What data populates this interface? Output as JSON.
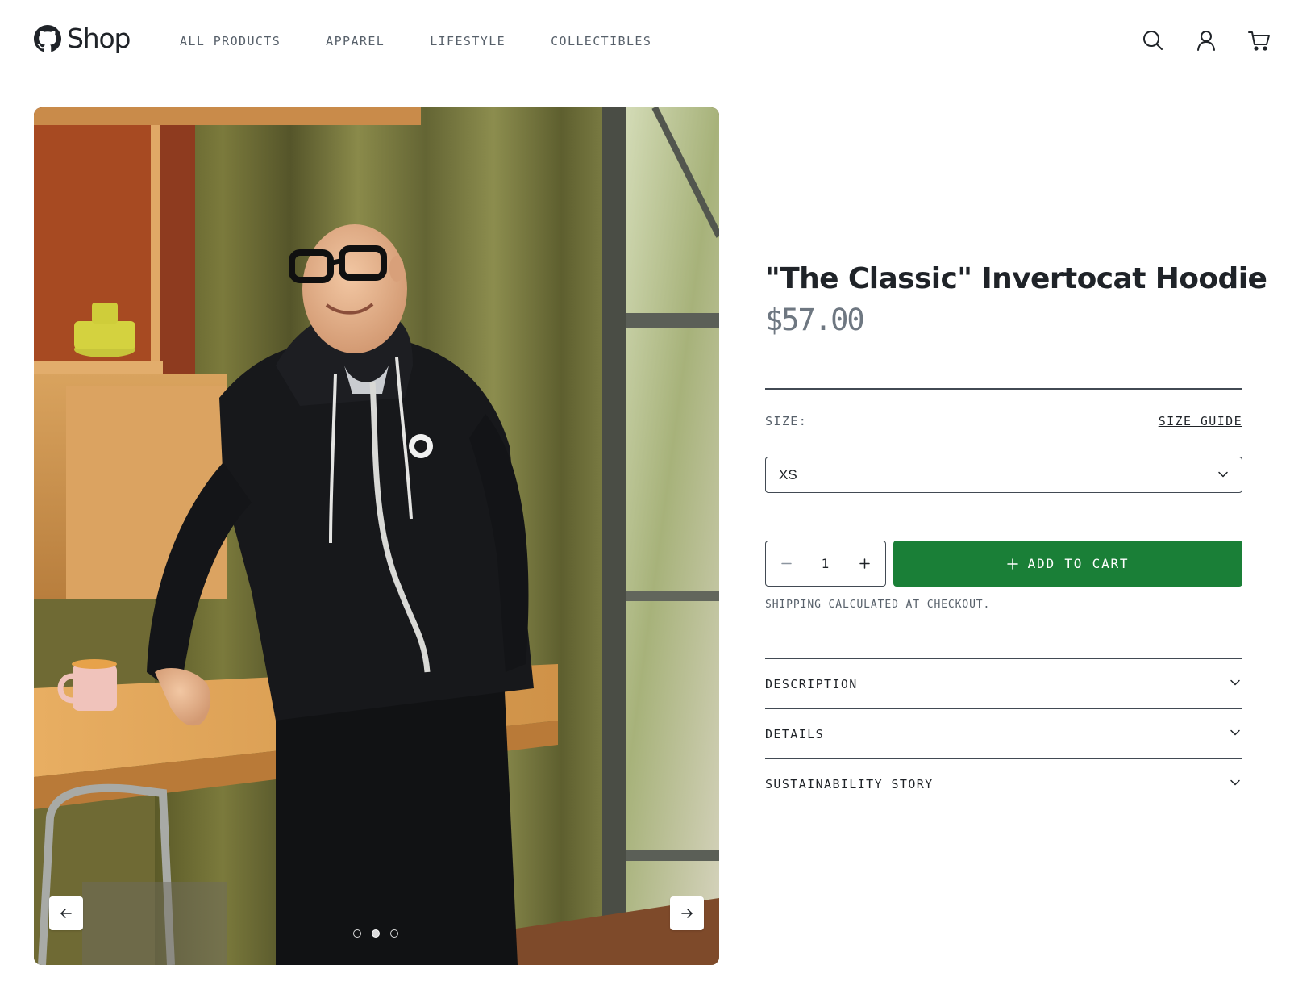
{
  "header": {
    "logo_text": "Shop",
    "nav": [
      {
        "label": "ALL PRODUCTS"
      },
      {
        "label": "APPAREL"
      },
      {
        "label": "LIFESTYLE"
      },
      {
        "label": "COLLECTIBLES"
      }
    ],
    "icons": [
      "search-icon",
      "account-icon",
      "cart-icon"
    ]
  },
  "gallery": {
    "image_count": 3,
    "active_index": 2,
    "prev_icon": "arrow-left-icon",
    "next_icon": "arrow-right-icon"
  },
  "product": {
    "title": "\"The Classic\" Invertocat Hoodie",
    "price": "$57.00",
    "size_label": "SIZE:",
    "size_guide": "SIZE GUIDE",
    "size_selected": "XS",
    "quantity": "1",
    "add_to_cart": "ADD TO CART",
    "shipping_note": "SHIPPING CALCULATED AT CHECKOUT."
  },
  "accordion": [
    {
      "label": "DESCRIPTION"
    },
    {
      "label": "DETAILS"
    },
    {
      "label": "SUSTAINABILITY STORY"
    }
  ],
  "colors": {
    "primary_button": "#1a7f37",
    "text": "#1f2328",
    "muted_text": "#57606a",
    "border": "#424a53"
  }
}
